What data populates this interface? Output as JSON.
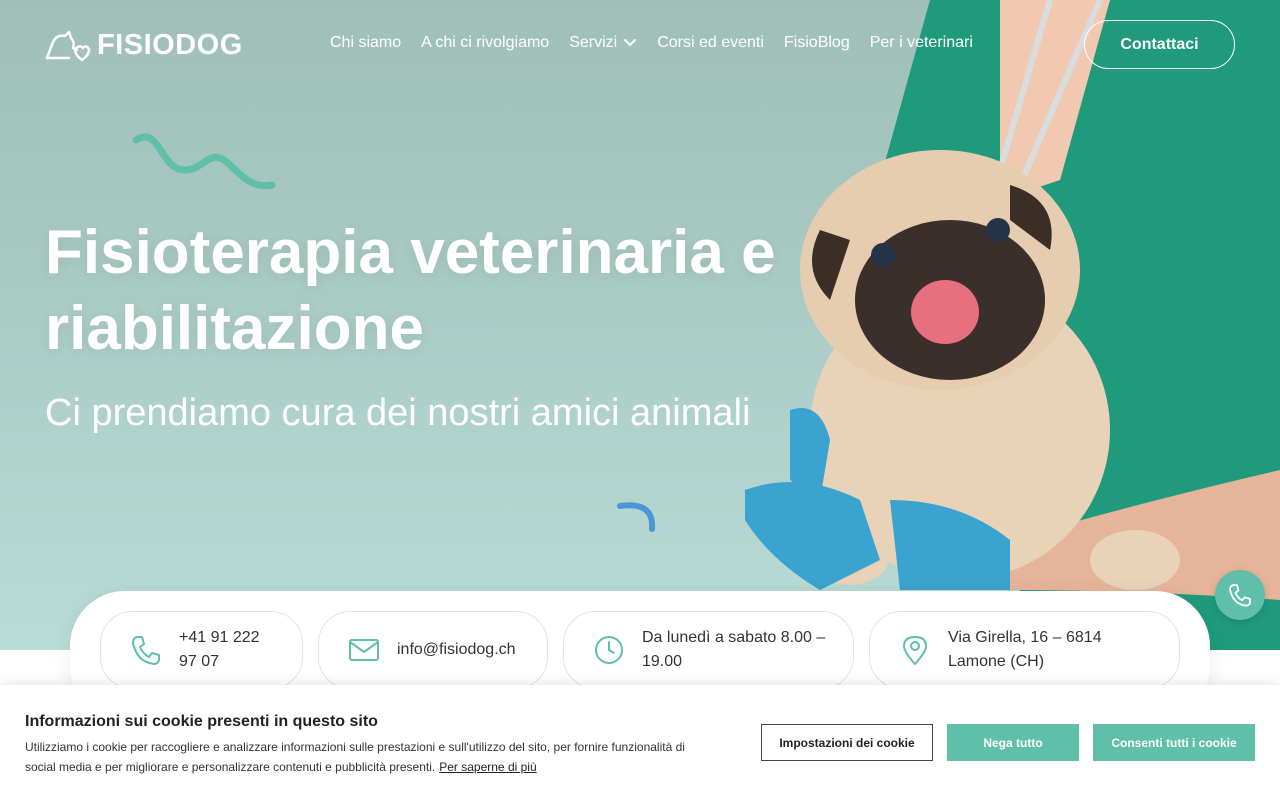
{
  "brand": {
    "name": "FISIODOG",
    "accent": "#5fbfa8"
  },
  "nav": {
    "items": [
      {
        "label": "Chi siamo"
      },
      {
        "label": "A chi ci rivolgiamo"
      },
      {
        "label": "Servizi",
        "dropdown": true
      },
      {
        "label": "Corsi ed eventi"
      },
      {
        "label": "FisioBlog"
      },
      {
        "label": "Per i veterinari"
      }
    ],
    "contact_label": "Contattaci"
  },
  "hero": {
    "title": "Fisioterapia veterinaria e riabilitazione",
    "subtitle": "Ci prendiamo cura dei nostri amici animali"
  },
  "info": {
    "phone": "+41 91 222 97 07",
    "email": "info@fisiodog.ch",
    "hours": "Da lunedì a sabato 8.00 – 19.00",
    "address": "Via Girella, 16 – 6814 Lamone (CH)"
  },
  "icons": {
    "phone": "phone-icon",
    "email": "mail-icon",
    "hours": "clock-icon",
    "address": "location-pin-icon",
    "fab": "phone-icon"
  },
  "cookie": {
    "title": "Informazioni sui cookie presenti in questo sito",
    "text": "Utilizziamo i cookie per raccogliere e analizzare informazioni sulle prestazioni e sull'utilizzo del sito, per fornire funzionalità di social media e per migliorare e personalizzare contenuti e pubblicità presenti.",
    "link": "Per saperne di più",
    "settings_label": "Impostazioni dei cookie",
    "deny_label": "Nega tutto",
    "allow_label": "Consenti tutti i cookie"
  }
}
